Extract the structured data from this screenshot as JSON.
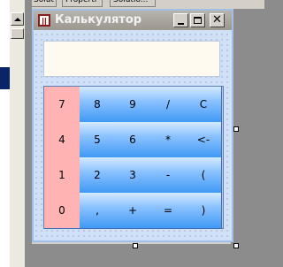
{
  "tabs": [
    "Solut",
    "Properti",
    "Solutio..."
  ],
  "form": {
    "title": "Калькулятор",
    "display_value": "",
    "caption_buttons": {
      "minimize": "_",
      "maximize": "□",
      "close": "X"
    }
  },
  "keypad": {
    "rows": [
      [
        {
          "label": "7",
          "style": "pink"
        },
        {
          "label": "8",
          "style": "blue"
        },
        {
          "label": "9",
          "style": "blue"
        },
        {
          "label": "/",
          "style": "blue"
        },
        {
          "label": "C",
          "style": "blue"
        }
      ],
      [
        {
          "label": "4",
          "style": "pink"
        },
        {
          "label": "5",
          "style": "blue"
        },
        {
          "label": "6",
          "style": "blue"
        },
        {
          "label": "*",
          "style": "blue"
        },
        {
          "label": "<-",
          "style": "blue"
        }
      ],
      [
        {
          "label": "1",
          "style": "pink"
        },
        {
          "label": "2",
          "style": "blue"
        },
        {
          "label": "3",
          "style": "blue"
        },
        {
          "label": "-",
          "style": "blue"
        },
        {
          "label": "(",
          "style": "blue"
        }
      ],
      [
        {
          "label": "0",
          "style": "pink"
        },
        {
          "label": ",",
          "style": "blue"
        },
        {
          "label": "+",
          "style": "blue"
        },
        {
          "label": "=",
          "style": "blue"
        },
        {
          "label": ")",
          "style": "blue"
        }
      ]
    ]
  },
  "colors": {
    "digit_key": "#ffb3b3",
    "op_key_top": "#d6e9ff",
    "op_key_bottom": "#3f99f5",
    "display_bg": "#fffaf0",
    "form_bg": "#cfe0f7"
  }
}
